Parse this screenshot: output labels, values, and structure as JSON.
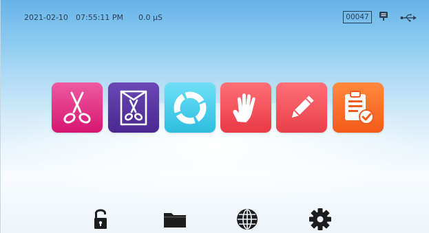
{
  "status_bar": {
    "date": "2021-02-10",
    "time": "07:55:11 PM",
    "conductivity": "0.0 µS",
    "counter": "00047",
    "icons": [
      "message-icon",
      "usb-icon"
    ]
  },
  "program_tiles": [
    {
      "icon": "scissors-icon",
      "color": "#d61672"
    },
    {
      "icon": "pouched-scissors-icon",
      "color": "#4a2890"
    },
    {
      "icon": "cycle-ring-icon",
      "color": "#2cbde0"
    },
    {
      "icon": "glove-icon",
      "color": "#e83a45"
    },
    {
      "icon": "pencil-icon",
      "color": "#e8404a"
    },
    {
      "icon": "clipboard-check-icon",
      "color": "#f25a1c"
    }
  ],
  "bottom_nav": {
    "icons": [
      "unlock-icon",
      "folder-icon",
      "globe-icon",
      "gear-icon"
    ]
  },
  "colors": {
    "background_top": "#66b3e8",
    "background_bottom": "#f7fbfe",
    "status_text": "#2b3f55"
  }
}
